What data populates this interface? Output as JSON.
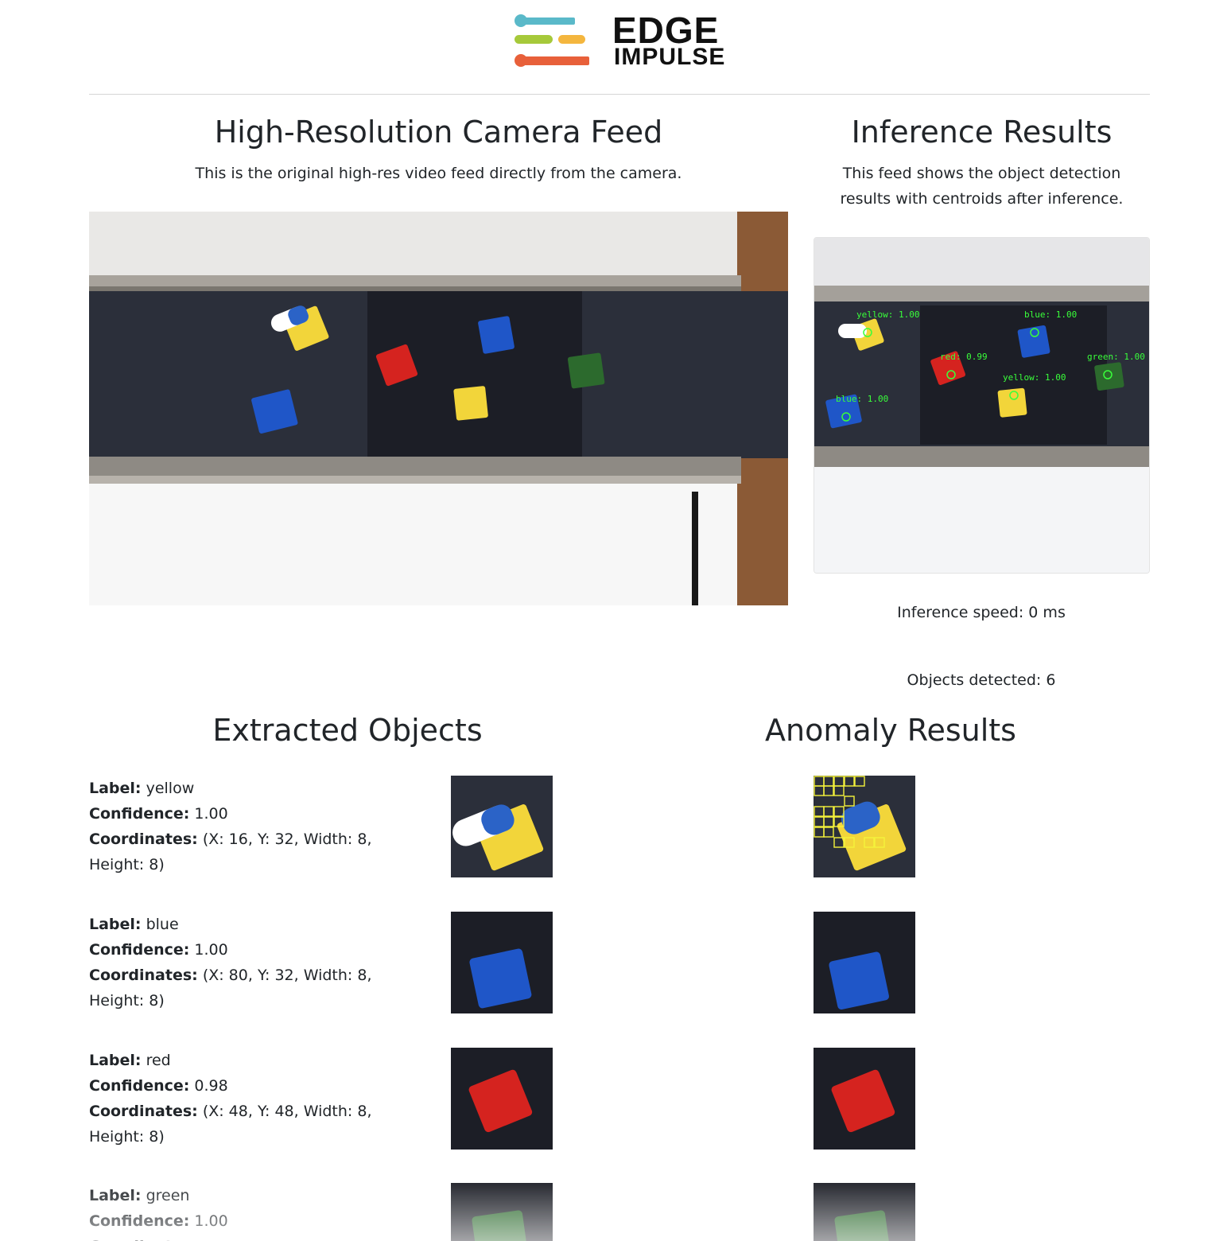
{
  "brand": {
    "line1": "EDGE",
    "line2": "IMPULSE"
  },
  "feed": {
    "title": "High-Resolution Camera Feed",
    "description": "This is the original high-res video feed directly from the camera."
  },
  "inference": {
    "title": "Inference Results",
    "description": "This feed shows the object detection results with centroids after inference.",
    "speed_text": "Inference speed: 0 ms",
    "objects_text": "Objects detected: 6",
    "overlay_labels": [
      "yellow: 1.00",
      "blue: 1.00",
      "red: 0.99",
      "green: 1.00",
      "yellow: 1.00",
      "blue: 1.00"
    ]
  },
  "extracted": {
    "title": "Extracted Objects",
    "field_labels": {
      "label": "Label:",
      "confidence": "Confidence:",
      "coordinates": "Coordinates:"
    },
    "items": [
      {
        "label": "yellow",
        "confidence": "1.00",
        "coords": "(X: 16, Y: 32, Width: 8, Height: 8)"
      },
      {
        "label": "blue",
        "confidence": "1.00",
        "coords": "(X: 80, Y: 32, Width: 8, Height: 8)"
      },
      {
        "label": "red",
        "confidence": "0.98",
        "coords": "(X: 48, Y: 48, Width: 8, Height: 8)"
      },
      {
        "label": "green",
        "confidence": "1.00",
        "coords": ""
      }
    ]
  },
  "anomaly": {
    "title": "Anomaly Results"
  },
  "colors": {
    "belt": "#2b2f3a",
    "belt_dark": "#1c1e26",
    "yellow_block": "#f2d53a",
    "blue_block": "#1f56c8",
    "red_block": "#d5231f",
    "green_block": "#2c6a2d",
    "detection_green": "#39ff3a",
    "anomaly_yellow": "#f5f23b"
  }
}
